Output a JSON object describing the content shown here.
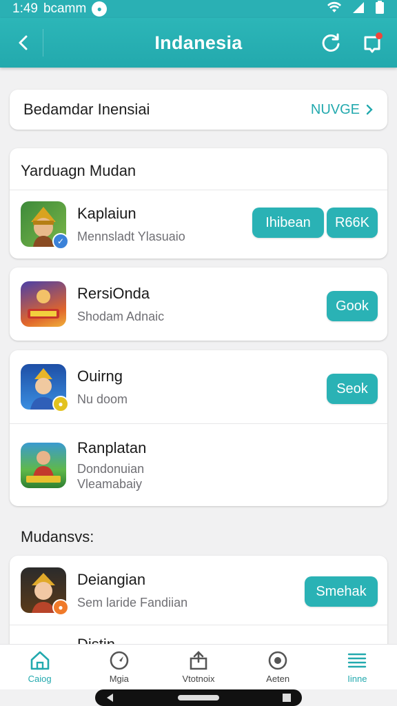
{
  "status_bar": {
    "time": "1:49",
    "carrier": "bcamm",
    "icons": [
      "wifi-icon",
      "signal-icon",
      "battery-icon"
    ]
  },
  "app_bar": {
    "title": "Indanesia",
    "back_icon": "back-arrow-icon",
    "actions": [
      "refresh-icon",
      "notification-icon"
    ],
    "accent": "#2ab0b4"
  },
  "banner": {
    "text": "Bedamdar Inensiai",
    "link_label": "NUVGE"
  },
  "section1": {
    "title": "Yarduagn Mudan",
    "items": [
      {
        "name": "Kaplaiun",
        "sub": "Mennsladt Ylasuaio",
        "buttons": [
          "Ihibean",
          "R66K"
        ]
      }
    ]
  },
  "card2": {
    "name": "RersiOnda",
    "sub": "Shodam Adnaic",
    "button": "Gook"
  },
  "card3": {
    "items": [
      {
        "name": "Ouirng",
        "sub": "Nu doom",
        "button": "Seok"
      },
      {
        "name": "Ranplatan",
        "sub_lines": [
          "Dondonuian",
          "Vleamabaiy"
        ]
      }
    ]
  },
  "section2": {
    "title": "Mudansvs:",
    "items": [
      {
        "name": "Deiangian",
        "sub": "Sem laride Fandiian",
        "button": "Smehak"
      },
      {
        "name": "Distin"
      }
    ]
  },
  "bottom_nav": {
    "items": [
      {
        "label": "Caiog",
        "icon": "home-icon"
      },
      {
        "label": "Mgia",
        "icon": "compass-icon"
      },
      {
        "label": "Vtotnoix",
        "icon": "upload-icon"
      },
      {
        "label": "Aeten",
        "icon": "record-icon"
      },
      {
        "label": "Iinne",
        "icon": "menu-icon"
      }
    ],
    "active_index": 4
  }
}
